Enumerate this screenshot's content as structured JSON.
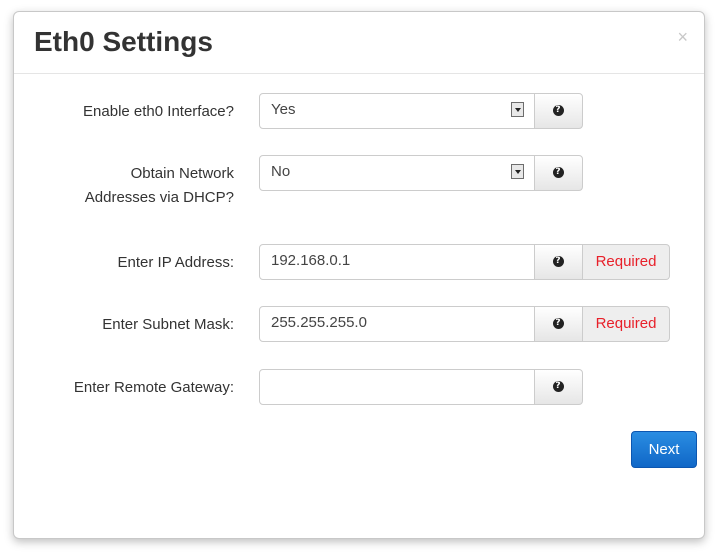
{
  "dialog": {
    "title": "Eth0 Settings",
    "close_label": "×"
  },
  "fields": {
    "enable_interface": {
      "label": "Enable eth0 Interface?",
      "value": "Yes"
    },
    "dhcp": {
      "label_line1": "Obtain Network",
      "label_line2": "Addresses via DHCP?",
      "value": "No"
    },
    "ip_address": {
      "label": "Enter IP Address:",
      "value": "192.168.0.1",
      "status": "Required"
    },
    "subnet_mask": {
      "label": "Enter Subnet Mask:",
      "value": "255.255.255.0",
      "status": "Required"
    },
    "remote_gateway": {
      "label": "Enter Remote Gateway:",
      "value": ""
    }
  },
  "help_icon_glyph": "?",
  "actions": {
    "next_label": "Next"
  },
  "colors": {
    "required_text": "#e8202a",
    "primary_button": "#1a7ad4"
  }
}
